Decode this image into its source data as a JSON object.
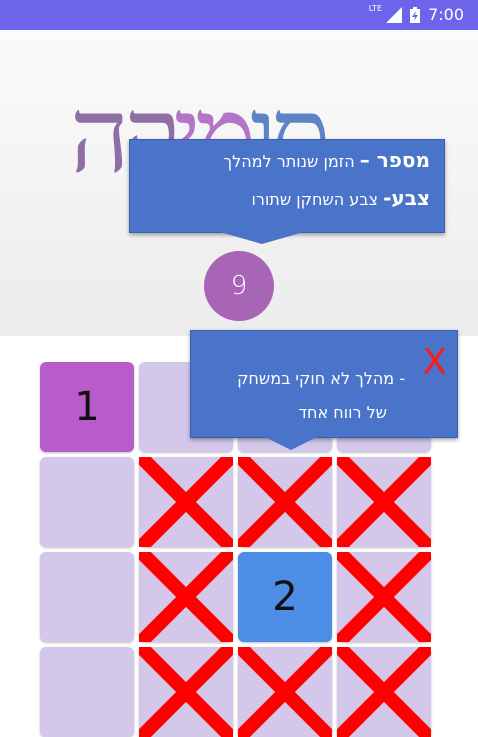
{
  "status_bar": {
    "network": "LTE",
    "time": "7:00"
  },
  "logo": {
    "letters": [
      "ס",
      "ו",
      "מ",
      "י",
      "ק",
      "ה"
    ]
  },
  "tooltip_top": {
    "line1_bold": "מספר –",
    "line1_text": "הזמן שנותר למהלך",
    "line2_bold": "צבע-",
    "line2_text": "צבע השחקן שתורו"
  },
  "timer": {
    "value": "9"
  },
  "tooltip_bottom": {
    "mark": "X",
    "line1": "- מהלך לא חוקי במשחק",
    "line2": "של רווח אחד"
  },
  "board": {
    "cells": [
      {
        "row": 0,
        "col": 0,
        "label": "1",
        "color": "purple",
        "crossed": false
      },
      {
        "row": 0,
        "col": 1,
        "label": "",
        "color": "empty",
        "crossed": false
      },
      {
        "row": 0,
        "col": 2,
        "label": "",
        "color": "empty",
        "crossed": false
      },
      {
        "row": 0,
        "col": 3,
        "label": "",
        "color": "empty",
        "crossed": false
      },
      {
        "row": 1,
        "col": 0,
        "label": "",
        "color": "empty",
        "crossed": false
      },
      {
        "row": 1,
        "col": 1,
        "label": "",
        "color": "empty",
        "crossed": true
      },
      {
        "row": 1,
        "col": 2,
        "label": "",
        "color": "empty",
        "crossed": true
      },
      {
        "row": 1,
        "col": 3,
        "label": "",
        "color": "empty",
        "crossed": true
      },
      {
        "row": 2,
        "col": 0,
        "label": "",
        "color": "empty",
        "crossed": false
      },
      {
        "row": 2,
        "col": 1,
        "label": "",
        "color": "empty",
        "crossed": true
      },
      {
        "row": 2,
        "col": 2,
        "label": "2",
        "color": "blue",
        "crossed": false
      },
      {
        "row": 2,
        "col": 3,
        "label": "",
        "color": "empty",
        "crossed": true
      },
      {
        "row": 3,
        "col": 0,
        "label": "",
        "color": "empty",
        "crossed": false
      },
      {
        "row": 3,
        "col": 1,
        "label": "",
        "color": "empty",
        "crossed": true
      },
      {
        "row": 3,
        "col": 2,
        "label": "",
        "color": "empty",
        "crossed": true
      },
      {
        "row": 3,
        "col": 3,
        "label": "",
        "color": "empty",
        "crossed": true
      }
    ]
  },
  "colors": {
    "status_bar": "#6c64ea",
    "tooltip": "#4a74c9",
    "timer": "#a865b5",
    "player1": "#b85ccc",
    "player2": "#4e8de6",
    "empty_cell": "#d3c8ea",
    "cross": "#ff0000"
  }
}
